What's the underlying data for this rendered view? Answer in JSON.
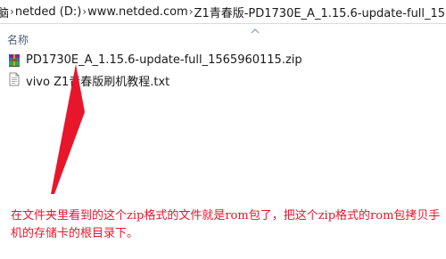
{
  "breadcrumb": {
    "items": [
      "脑",
      "netded (D:)",
      "www.netded.com",
      "Z1青春版-PD1730E_A_1.15.6-update-full_1565960115"
    ],
    "separator": "›"
  },
  "header": {
    "name_column_label": "名称"
  },
  "files": [
    {
      "name": "PD1730E_A_1.15.6-update-full_1565960115.zip",
      "icon": "winrar-archive-icon"
    },
    {
      "name": "vivo Z1青春版刷机教程.txt",
      "icon": "text-file-icon"
    }
  ],
  "annotation": {
    "text": "在文件夹里看到的这个zip格式的文件就是rom包了，把这个zip格式的rom包拷贝手机的存储卡的根目录下。",
    "color": "#e8162b"
  }
}
